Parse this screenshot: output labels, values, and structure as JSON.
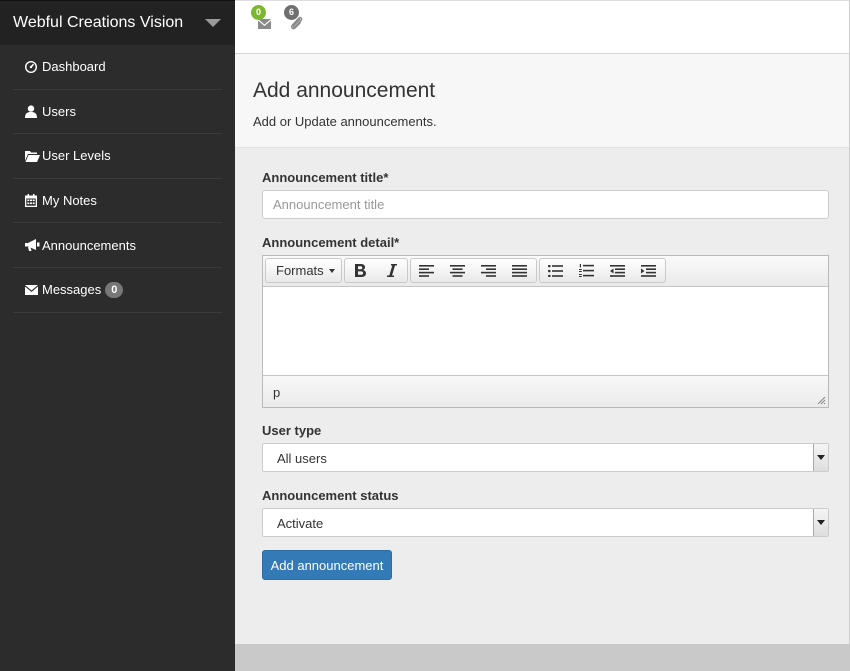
{
  "brand": {
    "title": "Webful Creations Vision"
  },
  "sidebar": {
    "items": [
      {
        "label": "Dashboard"
      },
      {
        "label": "Users"
      },
      {
        "label": "User Levels"
      },
      {
        "label": "My Notes"
      },
      {
        "label": "Announcements"
      },
      {
        "label": "Messages",
        "badge": "0"
      }
    ]
  },
  "topbar": {
    "messages_count": "0",
    "attachments_count": "6",
    "messages_badge_color": "#7cb82f",
    "attachments_badge_color": "#6f6f6f"
  },
  "header": {
    "title": "Add announcement",
    "subtitle": "Add or Update announcements."
  },
  "form": {
    "title_label": "Announcement title*",
    "title_placeholder": "Announcement title",
    "title_value": "",
    "detail_label": "Announcement detail*",
    "editor": {
      "formats_label": "Formats",
      "status_path": "p"
    },
    "user_type_label": "User type",
    "user_type_value": "All users",
    "status_label": "Announcement status",
    "status_value": "Activate",
    "submit_label": "Add announcement"
  },
  "colors": {
    "sidebar_bg": "#2c2c2c",
    "primary": "#337ab7"
  }
}
